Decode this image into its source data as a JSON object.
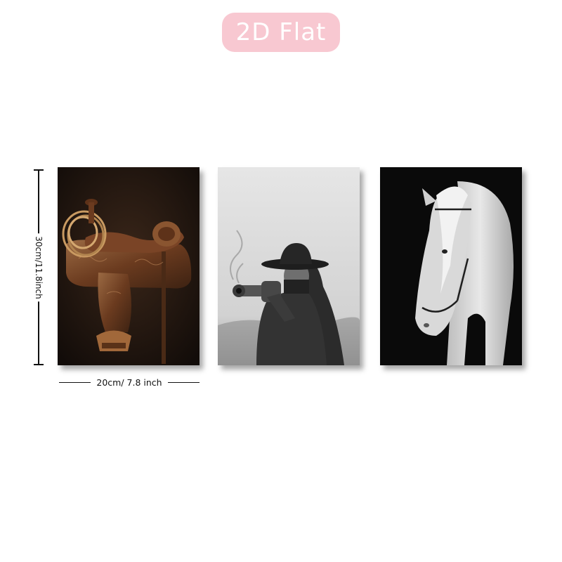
{
  "badge": {
    "label": "2D Flat",
    "color": "#f8c8d1",
    "text_color": "#ffffff"
  },
  "dimensions": {
    "height_label": "30cm/11.8inch",
    "width_label": "20cm/ 7.8 inch"
  },
  "panels": [
    {
      "subject": "leather western saddle with rope lasso",
      "palette": [
        "#1a130f",
        "#6b3b1f",
        "#a5744b",
        "#c99a61"
      ]
    },
    {
      "subject": "cowgirl in hat aiming revolver, black and white",
      "palette": [
        "#d8d8d8",
        "#8a8a8a",
        "#2a2a2a"
      ]
    },
    {
      "subject": "white horse with bridle on black background",
      "palette": [
        "#0b0b0b",
        "#cfcfcf",
        "#f2f2f2"
      ]
    }
  ]
}
